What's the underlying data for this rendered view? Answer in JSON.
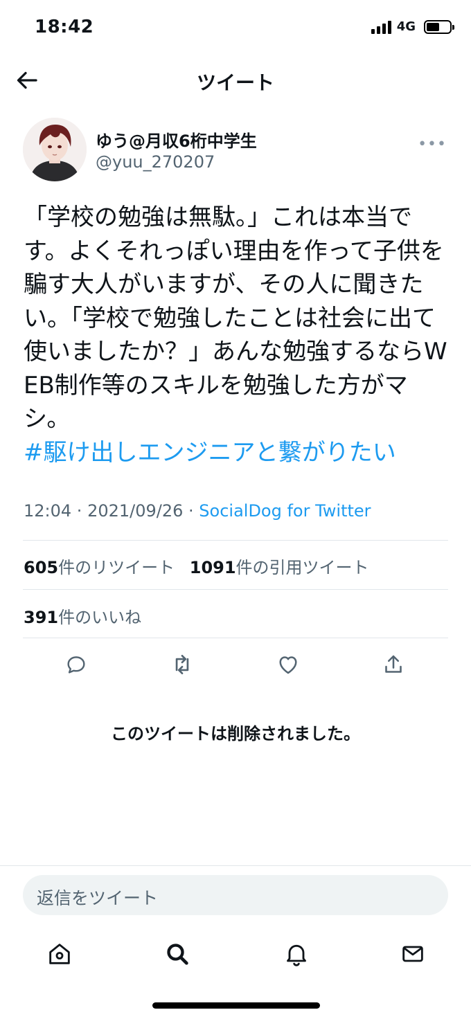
{
  "status": {
    "time": "18:42",
    "network": "4G"
  },
  "nav": {
    "title": "ツイート"
  },
  "tweet": {
    "display_name": "ゆう@月収6桁中学生",
    "handle": "@yuu_270207",
    "body": "「学校の勉強は無駄。」これは本当です。よくそれっぽい理由を作って子供を騙す大人がいますが、その人に聞きたい。「学校で勉強したことは社会に出て使いましたか？」あんな勉強するならWEB制作等のスキルを勉強した方がマシ。",
    "hashtag": "#駆け出しエンジニアと繋がりたい",
    "time": "12:04",
    "date": "2021/09/26",
    "source": "SocialDog for Twitter"
  },
  "stats": {
    "retweets_count": "605",
    "retweets_label": "件のリツイート",
    "quotes_count": "1091",
    "quotes_label": "件の引用ツイート",
    "likes_count": "391",
    "likes_label": "件のいいね"
  },
  "deleted_notice": "このツイートは削除されました。",
  "reply": {
    "placeholder": "返信をツイート"
  },
  "icons": {
    "back": "arrow-left-icon",
    "more": "more-horizontal-icon",
    "reply": "reply-icon",
    "retweet": "retweet-icon",
    "like": "heart-icon",
    "share": "share-icon",
    "tabs": [
      "home-icon",
      "search-icon",
      "notifications-icon",
      "messages-icon"
    ]
  },
  "colors": {
    "accent": "#1d9bf0",
    "secondary_text": "#536471",
    "primary_text": "#0f1419"
  }
}
